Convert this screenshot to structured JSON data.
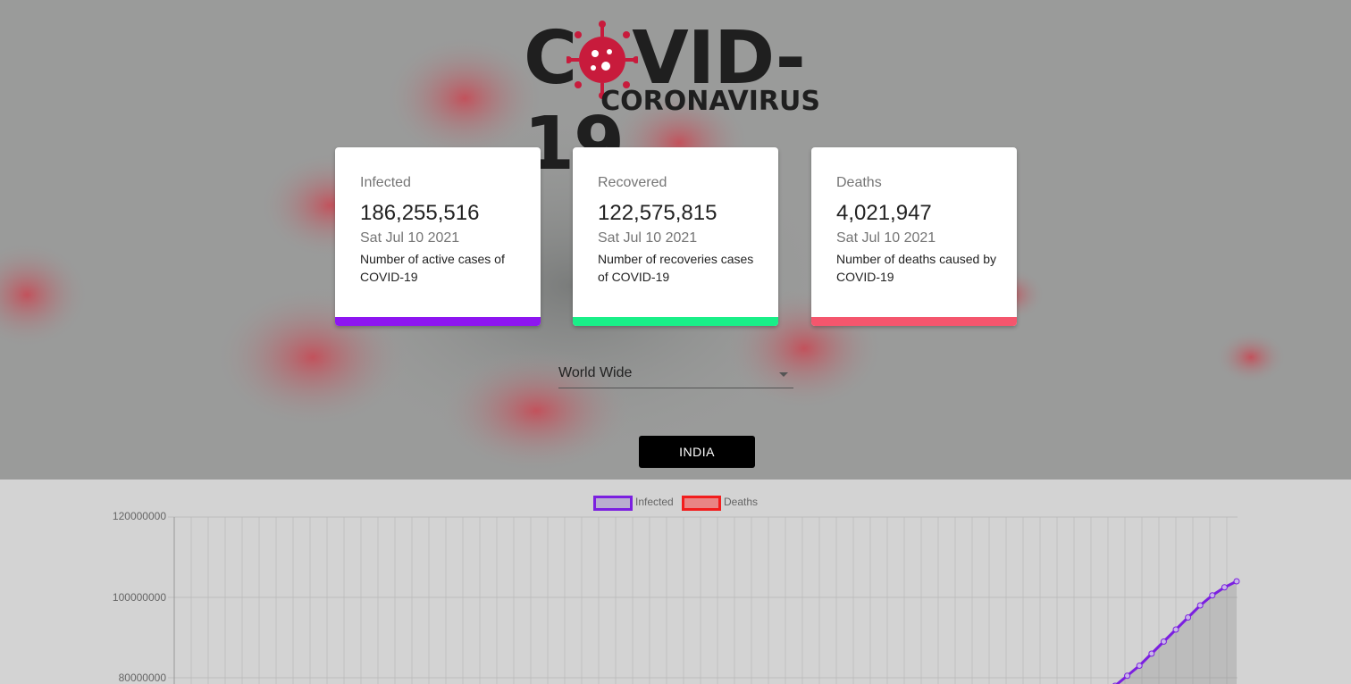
{
  "header": {
    "logo_main": "CVID-19",
    "logo_sub": "CORONAVIRUS"
  },
  "cards": [
    {
      "title": "Infected",
      "value": "186,255,516",
      "date": "Sat Jul 10 2021",
      "description": "Number of active cases of COVID-19",
      "color": "#8d16f0"
    },
    {
      "title": "Recovered",
      "value": "122,575,815",
      "date": "Sat Jul 10 2021",
      "description": "Number of recoveries cases of COVID-19",
      "color": "#19ef88"
    },
    {
      "title": "Deaths",
      "value": "4,021,947",
      "date": "Sat Jul 10 2021",
      "description": "Number of deaths caused by COVID-19",
      "color": "#f4566d"
    }
  ],
  "country_select": {
    "value": "World Wide"
  },
  "country_button": {
    "label": "INDIA"
  },
  "chart_data": {
    "type": "line",
    "legend": [
      "Infected",
      "Deaths"
    ],
    "series_colors": {
      "Infected": "#7b1fe0",
      "Deaths": "#f21d1d"
    },
    "y_ticks": [
      "120000000",
      "100000000",
      "80000000"
    ],
    "ylim": [
      80000000,
      120000000
    ],
    "series": [
      {
        "name": "Infected",
        "values": [
          78000000,
          80500000,
          83000000,
          86000000,
          89000000,
          92000000,
          95000000,
          98000000,
          100500000,
          102500000,
          104000000
        ]
      }
    ],
    "grid": true
  }
}
